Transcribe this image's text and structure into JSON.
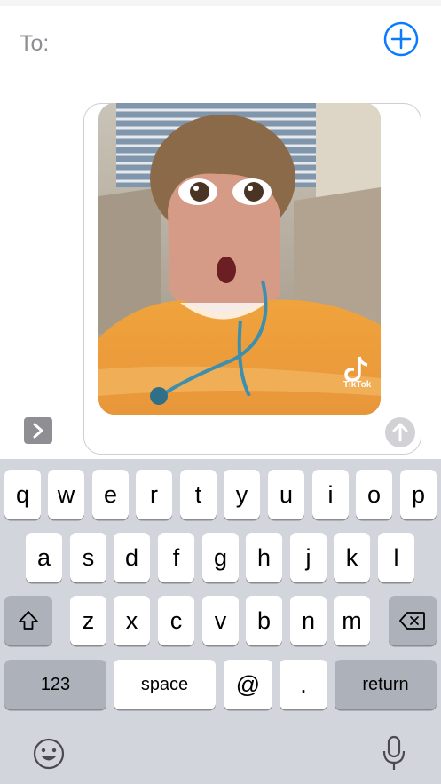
{
  "header": {
    "to_label": "To:"
  },
  "media": {
    "watermark": "TikTok"
  },
  "keyboard": {
    "row1": [
      "q",
      "w",
      "e",
      "r",
      "t",
      "y",
      "u",
      "i",
      "o",
      "p"
    ],
    "row2": [
      "a",
      "s",
      "d",
      "f",
      "g",
      "h",
      "j",
      "k",
      "l"
    ],
    "row3": [
      "z",
      "x",
      "c",
      "v",
      "b",
      "n",
      "m"
    ],
    "numbers_label": "123",
    "space_label": "space",
    "at_label": "@",
    "period_label": ".",
    "return_label": "return"
  },
  "colors": {
    "accent": "#0a7aff",
    "keyboard_bg": "#d2d5db",
    "key_dark": "#acb1ba"
  },
  "icons": [
    "add-recipient-icon",
    "send-arrow-icon",
    "expand-chevron-icon",
    "shift-icon",
    "delete-icon",
    "emoji-icon",
    "microphone-icon",
    "tiktok-logo-icon"
  ]
}
